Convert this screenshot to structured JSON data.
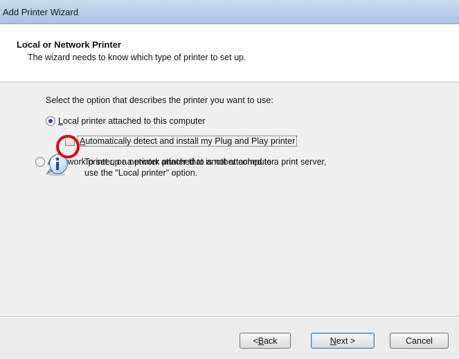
{
  "window": {
    "title": "Add Printer Wizard"
  },
  "header": {
    "title": "Local or Network Printer",
    "subtitle": "The wizard needs to know which type of printer to set up."
  },
  "body": {
    "prompt": "Select the option that describes the printer you want to use:",
    "options": {
      "local": {
        "mnemonic": "L",
        "rest": "ocal printer attached to this computer",
        "checked": true
      },
      "autodetect": {
        "mnemonic": "A",
        "rest": "utomatically detect and install my Plug and Play printer",
        "checked": false
      },
      "network": {
        "pre": "A ",
        "mnemonic": "n",
        "rest": "etwork printer, or a printer attached to another computer",
        "checked": false
      }
    },
    "info": {
      "icon": "info-icon",
      "line1": "To set up a network printer that is not attached to a print server,",
      "line2": "use the \"Local printer\" option."
    }
  },
  "buttons": {
    "back": {
      "prefix": "< ",
      "mnemonic": "B",
      "rest": "ack"
    },
    "next": {
      "mnemonic": "N",
      "rest": "ext >"
    },
    "cancel": {
      "label": "Cancel"
    }
  },
  "colors": {
    "highlight": "#e0000f",
    "radio_dot": "#2a4f86",
    "titlebar": "#b9d0e8"
  }
}
